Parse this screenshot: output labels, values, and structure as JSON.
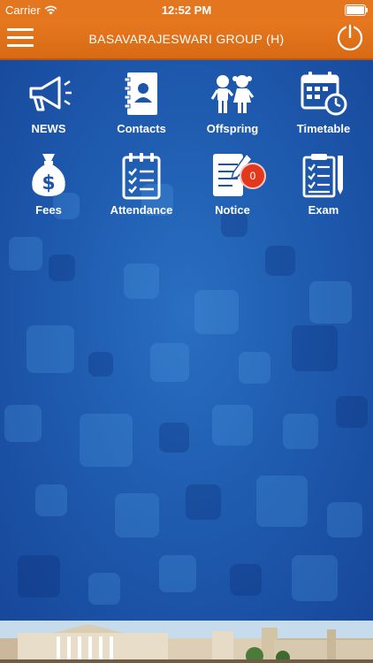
{
  "statusbar": {
    "carrier": "Carrier",
    "time": "12:52 PM"
  },
  "navbar": {
    "title": "BASAVARAJESWARI GROUP (H)",
    "menu_icon": "hamburger-menu-icon",
    "power_icon": "power-icon"
  },
  "tiles": [
    {
      "label": "NEWS",
      "icon": "megaphone-icon"
    },
    {
      "label": "Contacts",
      "icon": "contacts-book-icon"
    },
    {
      "label": "Offspring",
      "icon": "children-icon"
    },
    {
      "label": "Timetable",
      "icon": "calendar-clock-icon"
    },
    {
      "label": "Fees",
      "icon": "money-bag-icon"
    },
    {
      "label": "Attendance",
      "icon": "clipboard-check-icon"
    },
    {
      "label": "Notice",
      "icon": "notice-icon",
      "badge": "0"
    },
    {
      "label": "Exam",
      "icon": "exam-paper-icon"
    }
  ],
  "colors": {
    "header": "#e4761f",
    "background": "#1d56a8",
    "badge": "#e4381d"
  }
}
